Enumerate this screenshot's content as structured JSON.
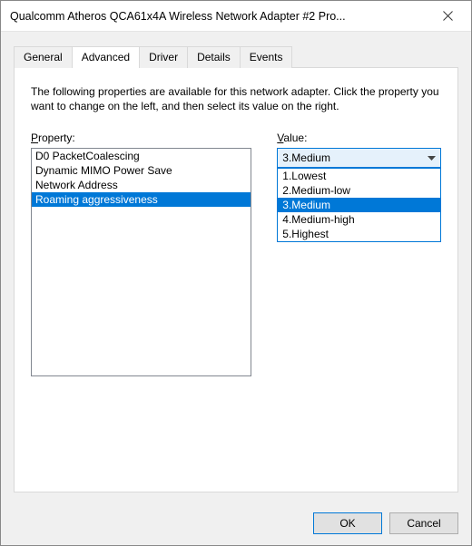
{
  "window": {
    "title": "Qualcomm Atheros QCA61x4A Wireless Network Adapter #2 Pro..."
  },
  "tabs": [
    {
      "label": "General"
    },
    {
      "label": "Advanced",
      "active": true
    },
    {
      "label": "Driver"
    },
    {
      "label": "Details"
    },
    {
      "label": "Events"
    }
  ],
  "panel": {
    "description": "The following properties are available for this network adapter. Click the property you want to change on the left, and then select its value on the right.",
    "property_label_pre": "P",
    "property_label_rest": "roperty:",
    "value_label_pre": "V",
    "value_label_rest": "alue:"
  },
  "properties": [
    {
      "label": "D0 PacketCoalescing"
    },
    {
      "label": "Dynamic MIMO Power Save"
    },
    {
      "label": "Network Address"
    },
    {
      "label": "Roaming aggressiveness",
      "selected": true
    }
  ],
  "value": {
    "selected": "3.Medium",
    "options": [
      {
        "label": "1.Lowest"
      },
      {
        "label": "2.Medium-low"
      },
      {
        "label": "3.Medium",
        "selected": true
      },
      {
        "label": "4.Medium-high"
      },
      {
        "label": "5.Highest"
      }
    ]
  },
  "buttons": {
    "ok": "OK",
    "cancel": "Cancel"
  }
}
